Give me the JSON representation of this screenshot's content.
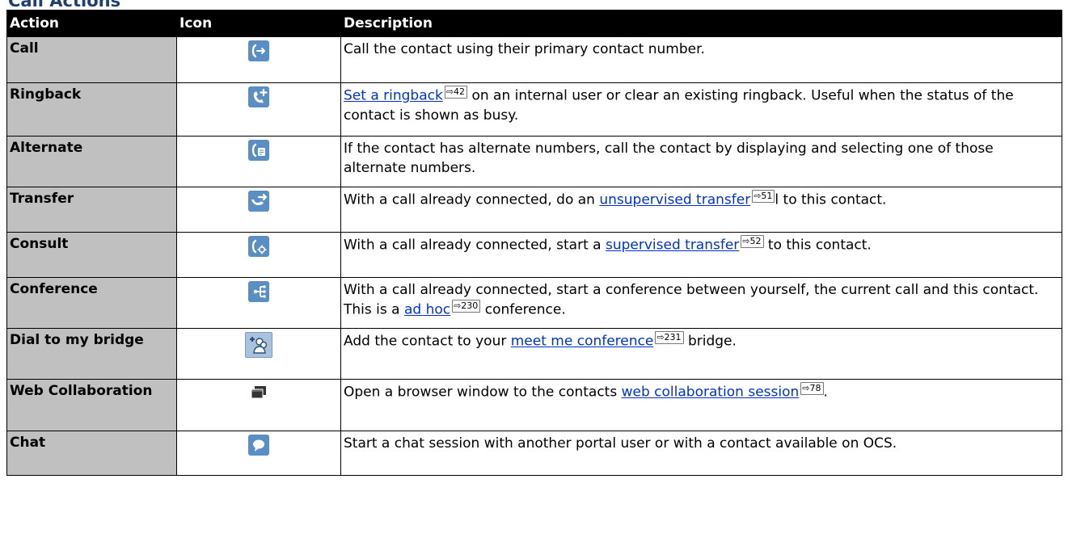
{
  "section": {
    "title": "Call Actions"
  },
  "table": {
    "headers": {
      "action": "Action",
      "icon": "Icon",
      "description": "Description"
    },
    "rows": [
      {
        "action": "Call",
        "icon": "call-arrow-icon",
        "pre": "Call the contact using their primary contact number.",
        "link": "",
        "ref": "",
        "post": ""
      },
      {
        "action": "Ringback",
        "icon": "ringback-icon",
        "pre": "",
        "link": "Set a ringback",
        "ref": "42",
        "post": " on an internal user or clear an existing ringback. Useful when the status of the contact is shown as busy."
      },
      {
        "action": "Alternate",
        "icon": "alternate-number-icon",
        "pre": "If the contact has alternate numbers, call the contact by displaying and selecting one of those alternate numbers.",
        "link": "",
        "ref": "",
        "post": ""
      },
      {
        "action": "Transfer",
        "icon": "transfer-icon",
        "pre": "With a call already connected, do an ",
        "link": "unsupervised transfer",
        "ref": "51",
        "post": "l to this contact."
      },
      {
        "action": "Consult",
        "icon": "consult-icon",
        "pre": "With a call already connected, start a ",
        "link": "supervised transfer",
        "ref": "52",
        "post": " to this contact."
      },
      {
        "action": "Conference",
        "icon": "conference-icon",
        "pre": "With a call already connected, start a conference between yourself, the current call and this contact. This is a ",
        "link": "ad hoc",
        "ref": "230",
        "post": " conference."
      },
      {
        "action": "Dial to my bridge",
        "icon": "dial-to-bridge-icon",
        "pre": "Add the contact to your ",
        "link": "meet me conference",
        "ref": "231",
        "post": " bridge."
      },
      {
        "action": "Web Collaboration",
        "icon": "web-collaboration-icon",
        "pre": "Open a browser window to the contacts ",
        "link": "web collaboration session",
        "ref": "78",
        "post": "."
      },
      {
        "action": "Chat",
        "icon": "chat-bubble-icon",
        "pre": "Start a chat session with another portal user or with a contact available on OCS.",
        "link": "",
        "ref": "",
        "post": ""
      }
    ]
  },
  "colors": {
    "header_bg": "#000000",
    "action_bg": "#c0c0c0",
    "icon_blue": "#5b8fc4",
    "link": "#0033cc"
  }
}
